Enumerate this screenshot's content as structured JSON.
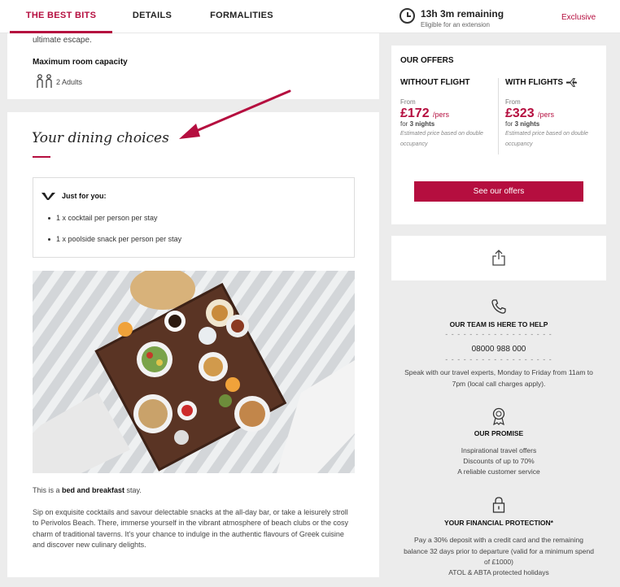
{
  "header": {
    "tabs": [
      {
        "label": "THE BEST BITS",
        "active": true
      },
      {
        "label": "DETAILS",
        "active": false
      },
      {
        "label": "FORMALITIES",
        "active": false
      }
    ],
    "timer": {
      "remaining": "13h 3m remaining",
      "note": "Eligible for an extension"
    },
    "exclusive_label": "Exclusive"
  },
  "room": {
    "intro_tail": "ultimate escape.",
    "capacity_heading": "Maximum room capacity",
    "capacity_value": "2 Adults"
  },
  "dining": {
    "title": "Your dining choices",
    "just_for_you": "Just for you:",
    "perks": [
      "1 x cocktail per person per stay",
      "1 x poolside snack per person per stay"
    ],
    "board_prefix": "This is a ",
    "board_type": "bed and breakfast",
    "board_suffix": " stay.",
    "description": "Sip on exquisite cocktails and savour delectable snacks at the all-day bar, or take a leisurely stroll to Perivolos Beach. There, immerse yourself in the vibrant atmosphere of beach clubs or the cosy charm of traditional taverns. It's your chance to indulge in the authentic flavours of Greek cuisine and discover new culinary delights."
  },
  "offers": {
    "heading": "OUR OFFERS",
    "columns": [
      {
        "title": "WITHOUT FLIGHT",
        "from": "From",
        "price": "£172",
        "unit": "/pers",
        "for_prefix": "for ",
        "nights": "3 nights",
        "note": "Estimated price based on double occupancy"
      },
      {
        "title": "WITH FLIGHTS",
        "from": "From",
        "price": "£323",
        "unit": "/pers",
        "for_prefix": "for ",
        "nights": "3 nights",
        "note": "Estimated price based on double occupancy"
      }
    ],
    "button": "See our offers"
  },
  "help": {
    "heading": "OUR TEAM IS HERE TO HELP",
    "divider": "- - - - - - - - - - - - - - - - - -",
    "phone": "08000 988 000",
    "text": "Speak with our travel experts, Monday to Friday from 11am to 7pm (local call charges apply)."
  },
  "promise": {
    "heading": "OUR PROMISE",
    "items": [
      "Inspirational travel offers",
      "Discounts of up to 70%",
      "A reliable customer service"
    ]
  },
  "protection": {
    "heading": "YOUR FINANCIAL PROTECTION*",
    "text": "Pay a 30% deposit with a credit card and the remaining balance 32 days prior to departure (valid for a minimum spend of £1000)",
    "atol": "ATOL & ABTA protected holidays"
  },
  "colors": {
    "accent": "#b50e3f",
    "background": "#ececec",
    "annotation_arrow": "#b50e3f"
  },
  "icons": [
    "clock-icon",
    "people-icon",
    "vlogo-icon",
    "plane-icon",
    "share-icon",
    "phone-icon",
    "award-icon",
    "lock-icon"
  ]
}
